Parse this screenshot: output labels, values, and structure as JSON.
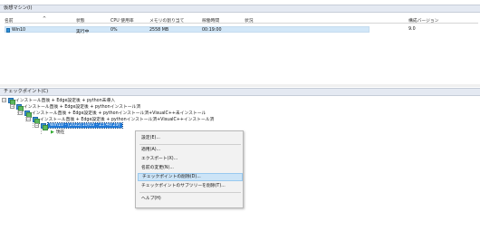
{
  "vm_panel": {
    "title": "仮想マシン(I)",
    "columns": [
      "名前",
      "状態",
      "CPU 使用率",
      "メモリの割り当て",
      "稼働時間",
      "状況",
      "構成バージョン"
    ],
    "rows": [
      {
        "name": "Win10",
        "state": "実行中",
        "cpu": "0%",
        "memory": "2558 MB",
        "uptime": "00:19:00",
        "status": "",
        "config_version": "9.0"
      }
    ]
  },
  "checkpoint_panel": {
    "title": "チェックポイント(C)",
    "tree": [
      {
        "label": "インストール直後 + Edge設定後 + python未導入"
      },
      {
        "label": "インストール直後 + Edge設定後 + pythonインストール済"
      },
      {
        "label": "インストール直後 + Edge設定後 + pythonインストール済+VisualC++未インストール"
      },
      {
        "label": "インストール直後 + Edge設定後 + pythonインストール済+VisualC++インストール済"
      },
      {
        "label": "Win10 - (2022/10/05 - 23:40:29)"
      },
      {
        "label": "現在"
      }
    ]
  },
  "context_menu": {
    "items": [
      {
        "label": "設定(E)..."
      },
      {
        "label": "適用(A)..."
      },
      {
        "label": "エクスポート(X)..."
      },
      {
        "label": "名前の変更(N)..."
      },
      {
        "label": "チェックポイントの削除(D)..."
      },
      {
        "label": "チェックポイントのサブツリーを削除(T)..."
      },
      {
        "label": "ヘルプ(H)"
      }
    ],
    "highlighted": "チェックポイントの削除(D)..."
  },
  "colors": {
    "header_bg": "#e4e9f2",
    "selection": "#1e78d7",
    "row_selected": "#d2e7f8",
    "menu_hover": "#cce4f7"
  }
}
